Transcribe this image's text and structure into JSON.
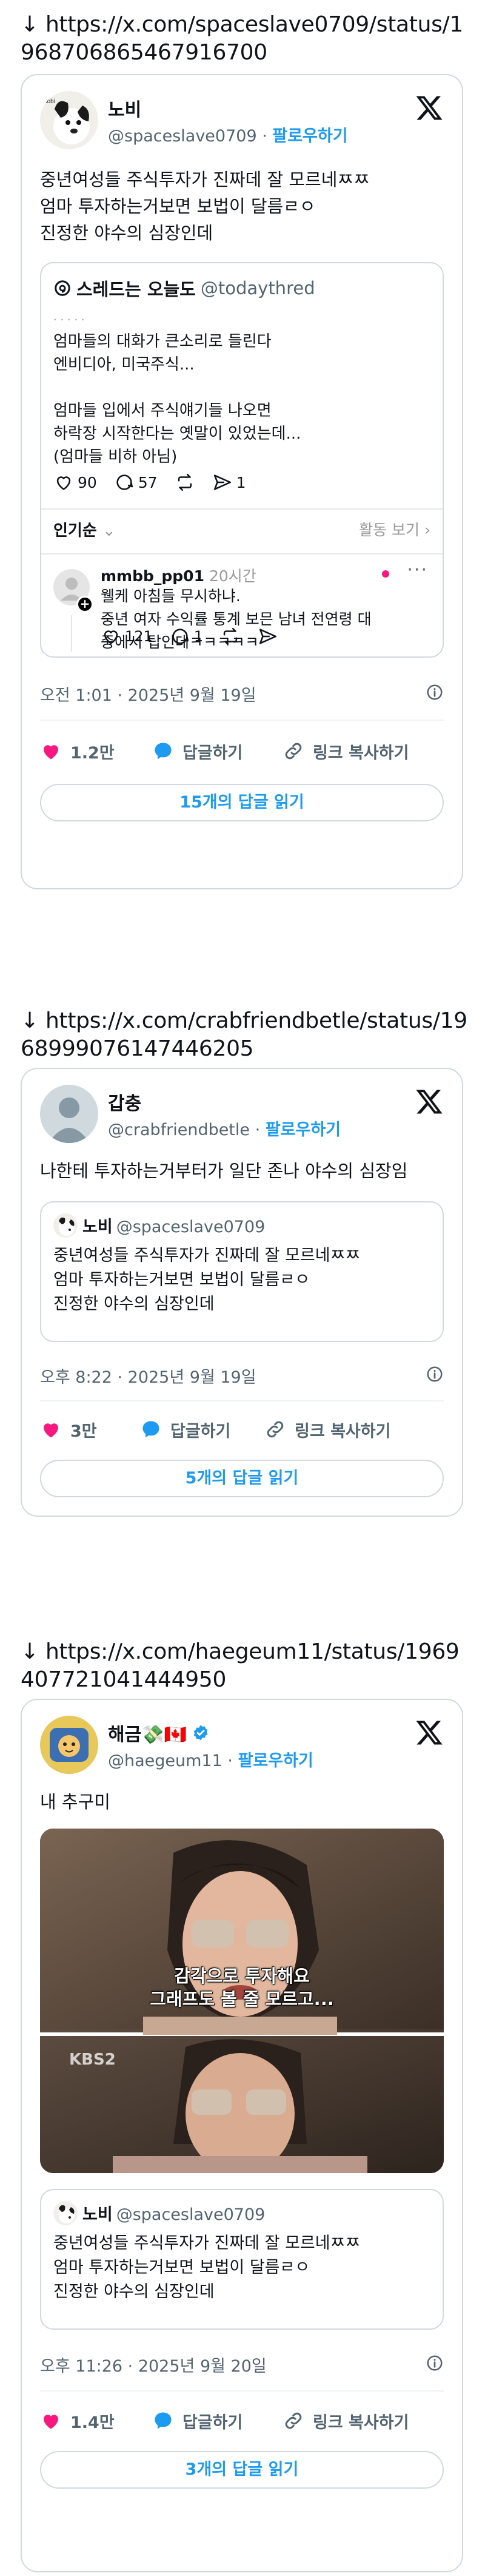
{
  "posts": [
    {
      "url_line": "↓ https://x.com/spaceslave0709/status/1968706865467916700",
      "name": "노비",
      "handle": "@spaceslave0709",
      "separator": "·",
      "follow": "팔로우하기",
      "text": "중년여성들 주식투자가 진짜데 잘 모르네ㅉㅉ\n엄마 투자하는거보면 보법이 달름ㄹㅇ\n진정한 야수의 심장인데",
      "embed": {
        "title": "스레드는 오늘도",
        "handle": "@todaythred",
        "cut_line": "· ·   · · ·",
        "text": "엄마들의 대화가 큰소리로 들린다\n엔비디아, 미국주식...\n\n엄마들 입에서 주식얘기들 나오면\n하락장 시작한다는 옛말이 있었는데...\n(엄마들 비하 아님)",
        "likes": "90",
        "comments": "57",
        "reposts": "",
        "shares": "1",
        "sort_label": "인기순",
        "activity_label": "활동 보기",
        "reply": {
          "name": "mmbb_pp01",
          "time": "20시간",
          "text": "웰케 아침들 무시하냐.\n중년 여자 수익률 통계 보믄 남녀 전연령 대\n중에서 탑인데ㅋㅋㅋㅋㅋ",
          "likes": "121",
          "comments": "1"
        }
      },
      "timestamp": "오전 1:01 · 2025년 9월 19일",
      "like_count": "1.2만",
      "reply_label": "답글하기",
      "copy_label": "링크 복사하기",
      "read_replies": "15개의 답글 읽기"
    },
    {
      "url_line": "↓ https://x.com/crabfriendbetle/status/1968999076147446205",
      "name": "갑충",
      "handle": "@crabfriendbetle",
      "separator": "·",
      "follow": "팔로우하기",
      "text": "나한테 투자하는거부터가 일단 존나 야수의 심장임",
      "quote": {
        "name": "노비",
        "handle": "@spaceslave0709",
        "text": "중년여성들 주식투자가 진짜데 잘 모르네ㅉㅉ\n엄마 투자하는거보면 보법이 달름ㄹㅇ\n진정한 야수의 심장인데"
      },
      "timestamp": "오후 8:22 · 2025년 9월 19일",
      "like_count": "3만",
      "reply_label": "답글하기",
      "copy_label": "링크 복사하기",
      "read_replies": "5개의 답글 읽기"
    },
    {
      "url_line": "↓ https://x.com/haegeum11/status/1969407721041444950",
      "name": "해금💸🇨🇦",
      "handle": "@haegeum11",
      "separator": "·",
      "follow": "팔로우하기",
      "text": "내 추구미",
      "media": {
        "caption_line1": "감각으로 투자해요",
        "caption_line2": "그래프도 볼 줄 모르고...",
        "watermark": "KBS2"
      },
      "quote": {
        "name": "노비",
        "handle": "@spaceslave0709",
        "text": "중년여성들 주식투자가 진짜데 잘 모르네ㅉㅉ\n엄마 투자하는거보면 보법이 달름ㄹㅇ\n진정한 야수의 심장인데"
      },
      "timestamp": "오후 11:26 · 2025년 9월 20일",
      "like_count": "1.4만",
      "reply_label": "답글하기",
      "copy_label": "링크 복사하기",
      "read_replies": "3개의 답글 읽기"
    }
  ],
  "colors": {
    "accent": "#1d9bf0",
    "like": "#f91880",
    "muted": "#536471",
    "border": "#cfd9de"
  },
  "icons": [
    "x-logo-icon",
    "heart-icon",
    "reply-bubble-icon",
    "link-icon",
    "info-icon",
    "threads-logo-icon",
    "comment-icon",
    "repost-icon",
    "send-icon",
    "verified-badge-icon",
    "chevron-down-icon",
    "chevron-right-icon",
    "more-icon"
  ]
}
